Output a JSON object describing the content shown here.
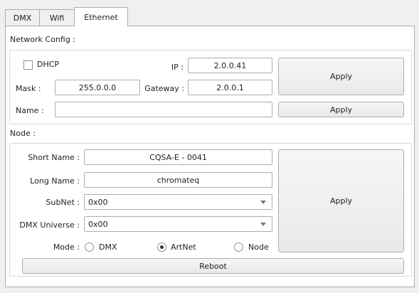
{
  "tabs": [
    {
      "label": "DMX",
      "active": false
    },
    {
      "label": "Wifi",
      "active": false
    },
    {
      "label": "Ethernet",
      "active": true
    }
  ],
  "network_config": {
    "heading": "Network Config :",
    "dhcp_label": "DHCP",
    "dhcp_checked": false,
    "ip_label": "IP :",
    "ip_value": "2.0.0.41",
    "mask_label": "Mask :",
    "mask_value": "255.0.0.0",
    "gateway_label": "Gateway :",
    "gateway_value": "2.0.0.1",
    "name_label": "Name :",
    "name_value": "",
    "apply_label": "Apply",
    "name_apply_label": "Apply"
  },
  "node": {
    "heading": "Node :",
    "short_name_label": "Short Name :",
    "short_name_value": "CQSA-E - 0041",
    "long_name_label": "Long Name :",
    "long_name_value": "chromateq",
    "subnet_label": "SubNet :",
    "subnet_value": "0x00",
    "dmx_universe_label": "DMX Universe :",
    "dmx_universe_value": "0x00",
    "mode_label": "Mode :",
    "mode_options": [
      {
        "label": "DMX",
        "checked": false
      },
      {
        "label": "ArtNet",
        "checked": true
      },
      {
        "label": "Node",
        "checked": false
      }
    ],
    "apply_label": "Apply",
    "reboot_label": "Reboot"
  }
}
